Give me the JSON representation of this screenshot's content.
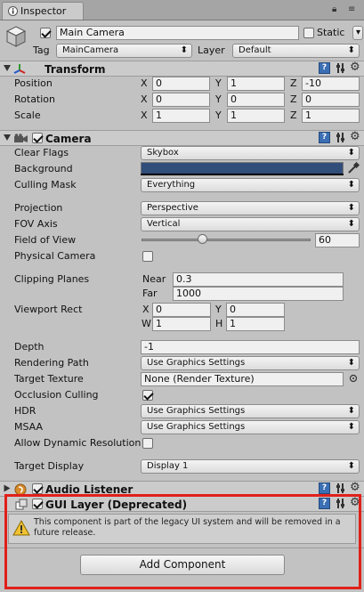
{
  "window": {
    "tab_label": "Inspector",
    "tab_icon": "inspector-info-icon",
    "tab_menu_icon": "kebab-menu-icon",
    "tab_lock_icon": "lock-icon"
  },
  "object": {
    "active": true,
    "name": "Main Camera",
    "static_label": "Static",
    "static_checked": false,
    "tag_label": "Tag",
    "tag_value": "MainCamera",
    "layer_label": "Layer",
    "layer_value": "Default"
  },
  "transform": {
    "title": "Transform",
    "rows": [
      {
        "label": "Position",
        "x": "0",
        "y": "1",
        "z": "-10"
      },
      {
        "label": "Rotation",
        "x": "0",
        "y": "0",
        "z": "0"
      },
      {
        "label": "Scale",
        "x": "1",
        "y": "1",
        "z": "1"
      }
    ],
    "axis": {
      "x": "X",
      "y": "Y",
      "z": "Z"
    }
  },
  "camera": {
    "title": "Camera",
    "enabled": true,
    "clear_flags_label": "Clear Flags",
    "clear_flags": "Skybox",
    "background_label": "Background",
    "background_color": "#314d79",
    "culling_mask_label": "Culling Mask",
    "culling_mask": "Everything",
    "projection_label": "Projection",
    "projection": "Perspective",
    "fov_axis_label": "FOV Axis",
    "fov_axis": "Vertical",
    "fov_label": "Field of View",
    "fov_value": "60",
    "fov_fraction": 0.36,
    "physical_label": "Physical Camera",
    "physical_checked": false,
    "clipping_label": "Clipping Planes",
    "near_label": "Near",
    "near_value": "0.3",
    "far_label": "Far",
    "far_value": "1000",
    "viewport_label": "Viewport Rect",
    "vp_x_label": "X",
    "vp_x": "0",
    "vp_y_label": "Y",
    "vp_y": "0",
    "vp_w_label": "W",
    "vp_w": "1",
    "vp_h_label": "H",
    "vp_h": "1",
    "depth_label": "Depth",
    "depth": "-1",
    "rendering_path_label": "Rendering Path",
    "rendering_path": "Use Graphics Settings",
    "target_texture_label": "Target Texture",
    "target_texture": "None (Render Texture)",
    "occlusion_label": "Occlusion Culling",
    "occlusion_checked": true,
    "hdr_label": "HDR",
    "hdr": "Use Graphics Settings",
    "msaa_label": "MSAA",
    "msaa": "Use Graphics Settings",
    "dyn_res_label": "Allow Dynamic Resolution",
    "dyn_res_checked": false,
    "target_display_label": "Target Display",
    "target_display": "Display 1"
  },
  "audio_listener": {
    "title": "Audio Listener",
    "enabled": true
  },
  "gui_layer": {
    "title": "GUI Layer (Deprecated)",
    "enabled": true,
    "warning": "This component is part of the legacy UI system and will be removed in a future release."
  },
  "add_component_label": "Add Component",
  "highlight_color": "#e0201b"
}
